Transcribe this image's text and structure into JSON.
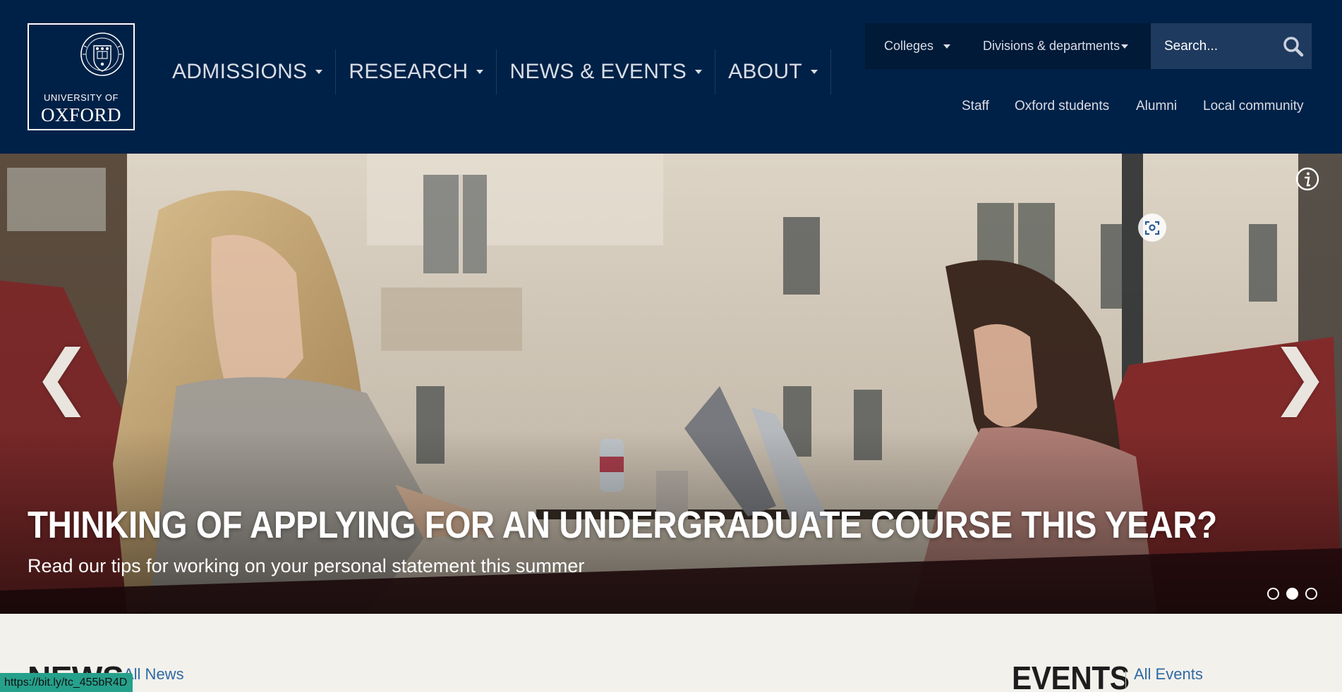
{
  "logo": {
    "line1": "UNIVERSITY OF",
    "line2": "OXFORD"
  },
  "mainnav": [
    {
      "label": "ADMISSIONS"
    },
    {
      "label": "RESEARCH"
    },
    {
      "label": "NEWS & EVENTS"
    },
    {
      "label": "ABOUT"
    }
  ],
  "utility": {
    "colleges": "Colleges",
    "divisions": "Divisions & departments",
    "search_placeholder": "Search..."
  },
  "audience": [
    "Staff",
    "Oxford students",
    "Alumni",
    "Local community"
  ],
  "hero": {
    "title": "THINKING OF APPLYING FOR AN UNDERGRADUATE COURSE THIS YEAR?",
    "subtitle": "Read our tips for working on your personal statement this summer",
    "prev_glyph": "❮",
    "next_glyph": "❯",
    "slides_total": 3,
    "active_slide": 2
  },
  "news": {
    "heading": "NEWS",
    "link": "All News"
  },
  "events": {
    "heading": "EVENTS",
    "link": "All Events"
  },
  "status_url": "https://bit.ly/tc_455bR4D",
  "colors": {
    "navy": "#002147",
    "util_bg": "#001a38",
    "search_bg": "#1f3a5f",
    "link": "#2f6aa3",
    "page_bg": "#f3f1ec",
    "status_bg": "#25a08b"
  }
}
